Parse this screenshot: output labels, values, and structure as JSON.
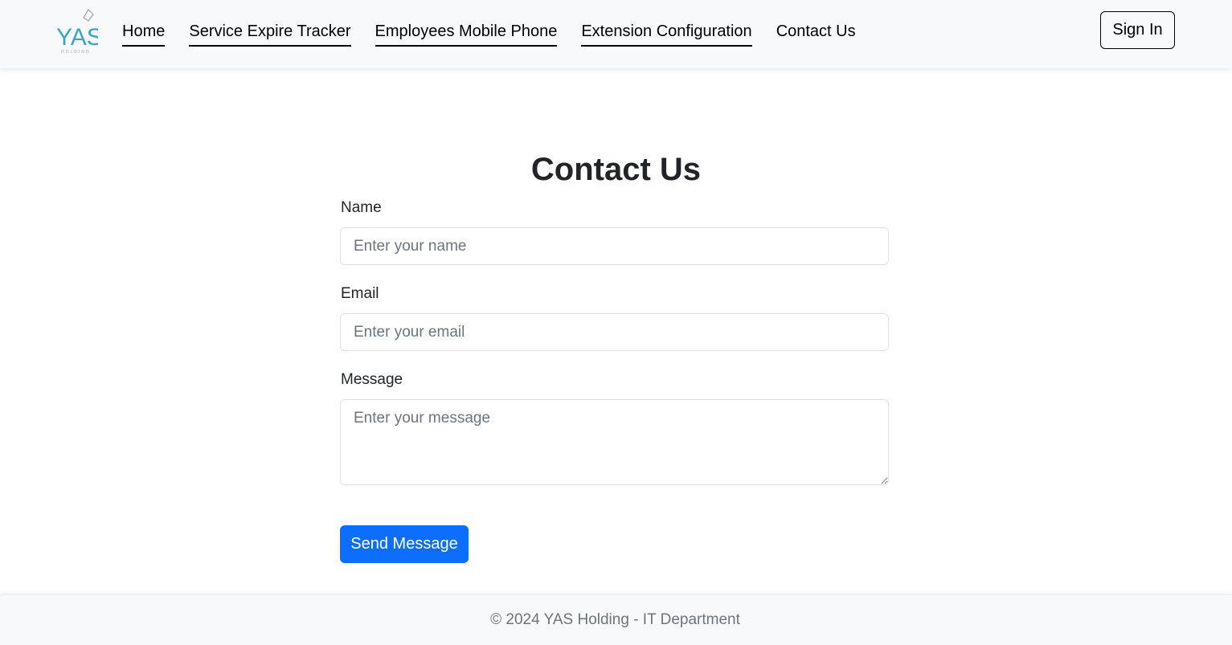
{
  "brand": {
    "logo_text": "YAS",
    "logo_subtext": "HOLDING",
    "accent_color": "#3aa6c0"
  },
  "nav": {
    "items": [
      {
        "label": "Home"
      },
      {
        "label": "Service Expire Tracker"
      },
      {
        "label": "Employees Mobile Phone"
      },
      {
        "label": "Extension Configuration"
      },
      {
        "label": "Contact Us"
      }
    ],
    "sign_in_label": "Sign In"
  },
  "form": {
    "title": "Contact Us",
    "name": {
      "label": "Name",
      "placeholder": "Enter your name",
      "value": ""
    },
    "email": {
      "label": "Email",
      "placeholder": "Enter your email",
      "value": ""
    },
    "message": {
      "label": "Message",
      "placeholder": "Enter your message",
      "value": ""
    },
    "submit_label": "Send Message",
    "submit_color": "#0d6efd"
  },
  "footer": {
    "text": "© 2024 YAS Holding - IT Department"
  }
}
